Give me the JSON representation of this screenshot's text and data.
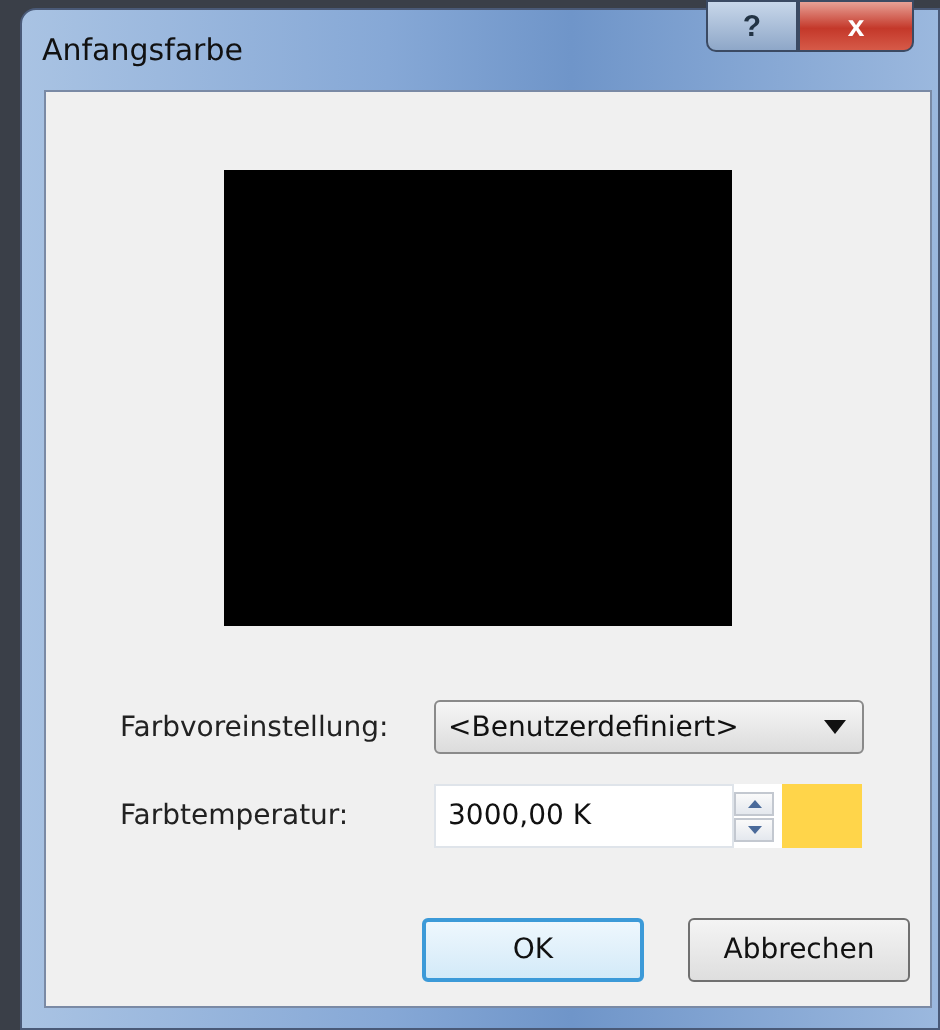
{
  "window": {
    "title": "Anfangsfarbe",
    "title_buttons": [
      {
        "kind": "help",
        "label": "?"
      },
      {
        "kind": "close",
        "label": "x"
      }
    ]
  },
  "preset": {
    "label": "Farbvoreinstellung:",
    "value": "<Benutzerdefiniert>"
  },
  "temperature": {
    "label": "Farbtemperatur:",
    "value": "3000,00 K"
  },
  "buttons": [
    {
      "label": "OK",
      "default": true
    },
    {
      "label": "Abbrechen",
      "default": false
    }
  ]
}
